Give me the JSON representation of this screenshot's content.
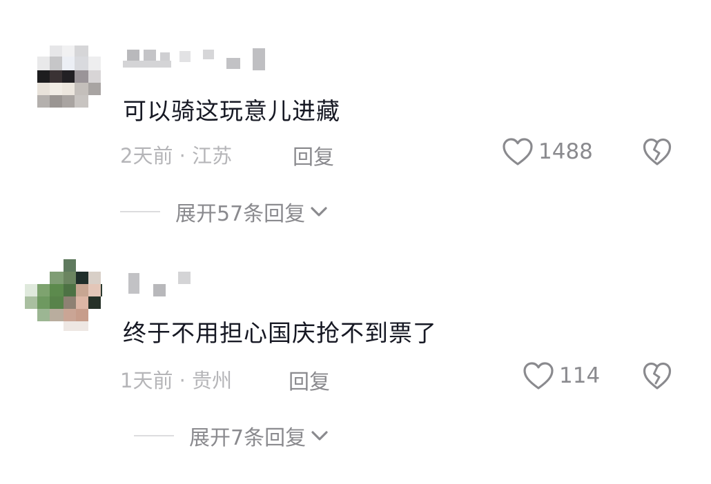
{
  "comments": [
    {
      "text": "可以骑这玩意儿进藏",
      "meta": "2天前 · 江苏",
      "reply_label": "回复",
      "like_count": "1488",
      "expand_label": "展开57条回复",
      "icons": {
        "like": "heart-outline-icon",
        "dislike": "broken-heart-icon",
        "expand": "chevron-down-icon"
      }
    },
    {
      "text": "终于不用担心国庆抢不到票了",
      "meta": "1天前 · 贵州",
      "reply_label": "回复",
      "like_count": "114",
      "expand_label": "展开7条回复",
      "icons": {
        "like": "heart-outline-icon",
        "dislike": "broken-heart-icon",
        "expand": "chevron-down-icon"
      }
    }
  ],
  "colors": {
    "text_primary": "#161823",
    "text_secondary": "#8a8a8e",
    "text_meta": "#b5b5b8",
    "icon": "#8a8a8e",
    "background": "#ffffff"
  }
}
